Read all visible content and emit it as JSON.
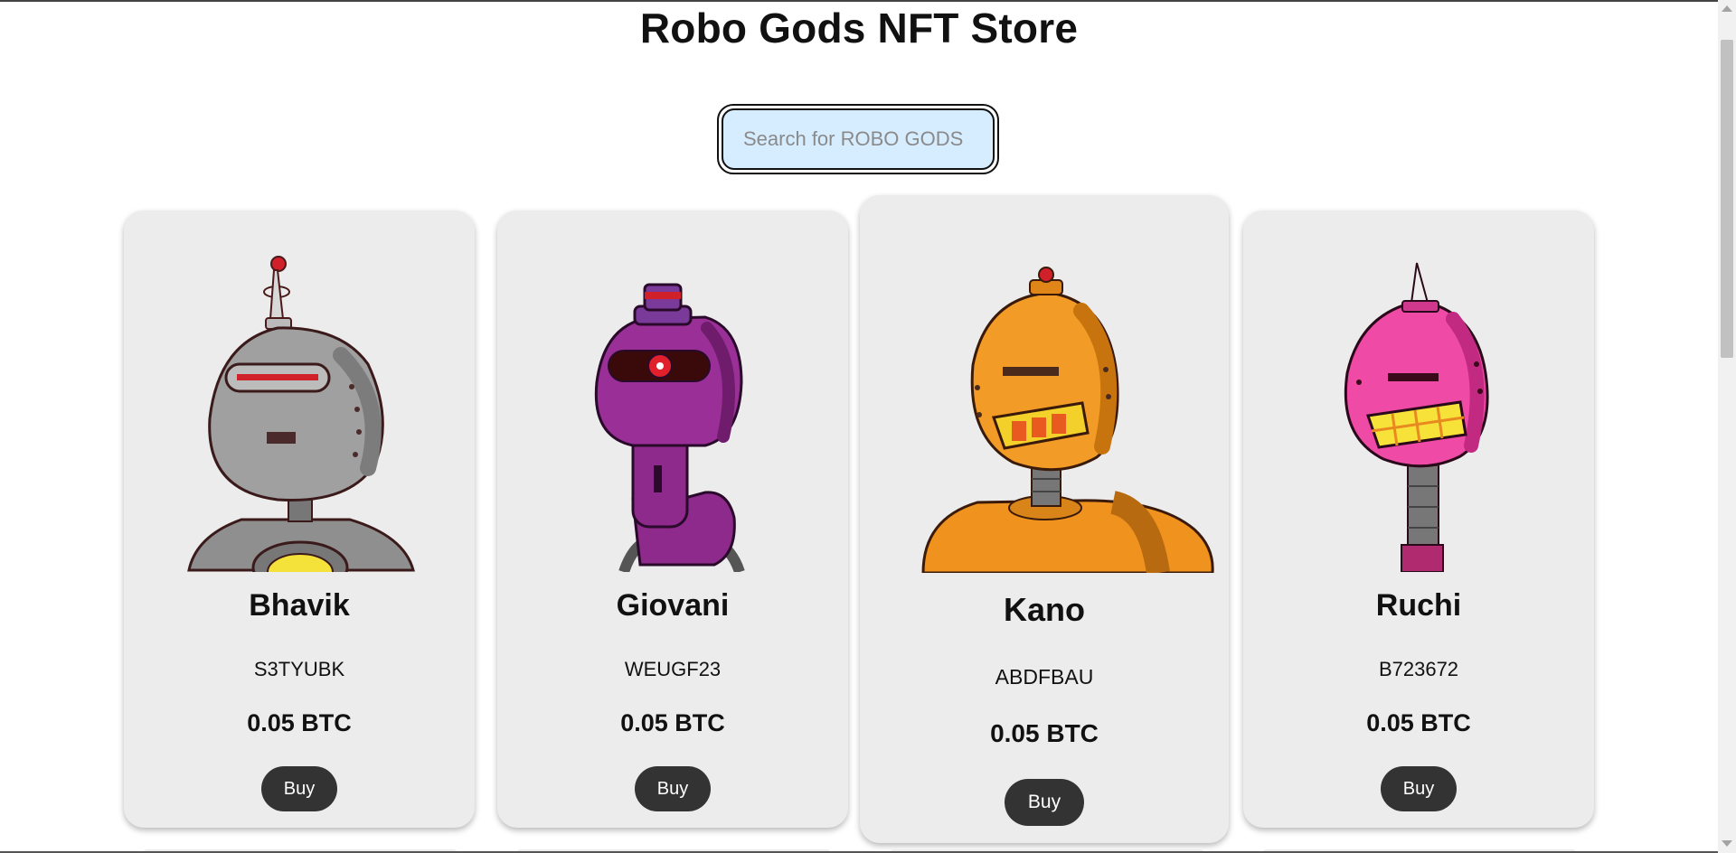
{
  "header": {
    "title": "Robo Gods NFT Store"
  },
  "search": {
    "placeholder": "Search for ROBO GODS",
    "value": ""
  },
  "products": [
    {
      "name": "Bhavik",
      "code": "S3TYUBK",
      "price": "0.05 BTC",
      "buy_label": "Buy",
      "robot": "gray-robot-icon",
      "color": "#9a9a9a"
    },
    {
      "name": "Giovani",
      "code": "WEUGF23",
      "price": "0.05 BTC",
      "buy_label": "Buy",
      "robot": "purple-robot-icon",
      "color": "#8e2a8c"
    },
    {
      "name": "Kano",
      "code": "ABDFBAU",
      "price": "0.05 BTC",
      "buy_label": "Buy",
      "robot": "orange-robot-icon",
      "color": "#f0921e"
    },
    {
      "name": "Ruchi",
      "code": "B723672",
      "price": "0.05 BTC",
      "buy_label": "Buy",
      "robot": "pink-robot-icon",
      "color": "#f04aa8"
    }
  ],
  "colors": {
    "card_bg": "#ececec",
    "button_bg": "#333333",
    "search_bg": "#d6ecff"
  }
}
